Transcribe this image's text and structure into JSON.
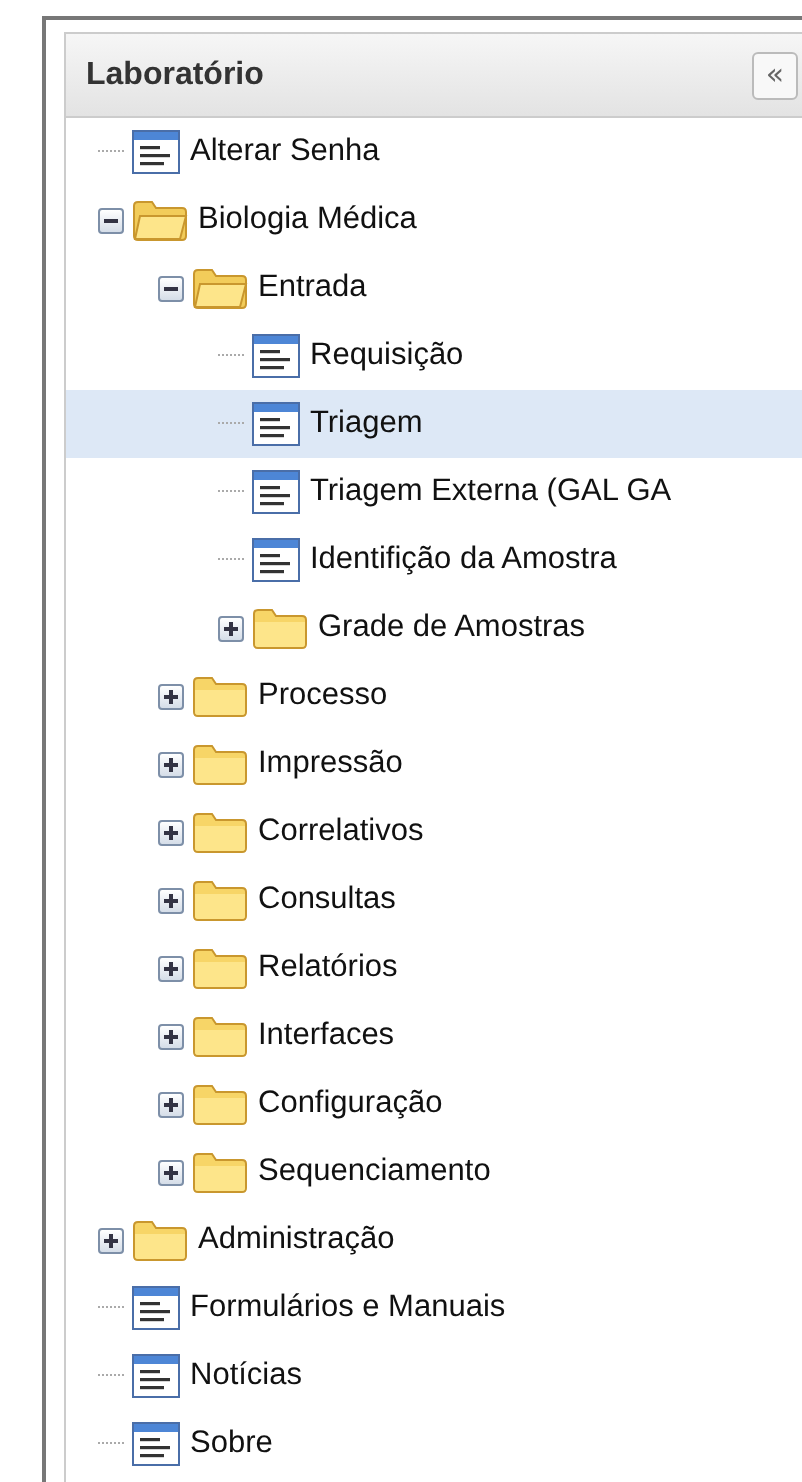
{
  "panel": {
    "title": "Laboratório",
    "collapse_button": "«"
  },
  "tree": [
    {
      "label": "Alterar Senha",
      "kind": "page",
      "selected": false
    },
    {
      "label": "Biologia Médica",
      "kind": "folder",
      "expanded": true,
      "selected": false,
      "children": [
        {
          "label": "Entrada",
          "kind": "folder",
          "expanded": true,
          "selected": false,
          "children": [
            {
              "label": "Requisição",
              "kind": "page",
              "selected": false
            },
            {
              "label": "Triagem",
              "kind": "page",
              "selected": true
            },
            {
              "label": "Triagem Externa (GAL GA",
              "kind": "page",
              "selected": false
            },
            {
              "label": "Identifição da Amostra",
              "kind": "page",
              "selected": false
            },
            {
              "label": "Grade de Amostras",
              "kind": "folder",
              "expanded": false,
              "selected": false
            }
          ]
        },
        {
          "label": "Processo",
          "kind": "folder",
          "expanded": false,
          "selected": false
        },
        {
          "label": "Impressão",
          "kind": "folder",
          "expanded": false,
          "selected": false
        },
        {
          "label": "Correlativos",
          "kind": "folder",
          "expanded": false,
          "selected": false
        },
        {
          "label": "Consultas",
          "kind": "folder",
          "expanded": false,
          "selected": false
        },
        {
          "label": "Relatórios",
          "kind": "folder",
          "expanded": false,
          "selected": false
        },
        {
          "label": "Interfaces",
          "kind": "folder",
          "expanded": false,
          "selected": false
        },
        {
          "label": "Configuração",
          "kind": "folder",
          "expanded": false,
          "selected": false
        },
        {
          "label": "Sequenciamento",
          "kind": "folder",
          "expanded": false,
          "selected": false
        }
      ]
    },
    {
      "label": "Administração",
      "kind": "folder",
      "expanded": false,
      "selected": false
    },
    {
      "label": "Formulários e Manuais",
      "kind": "page",
      "selected": false
    },
    {
      "label": "Notícias",
      "kind": "page",
      "selected": false
    },
    {
      "label": "Sobre",
      "kind": "page",
      "selected": false
    }
  ]
}
